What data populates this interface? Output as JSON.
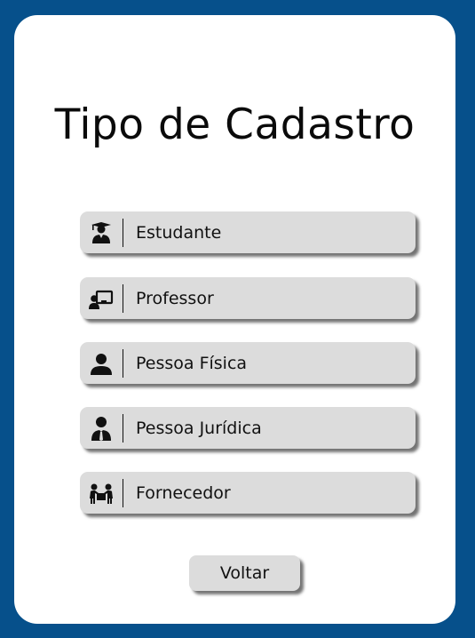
{
  "title": "Tipo de Cadastro",
  "options": [
    {
      "label": "Estudante",
      "icon": "graduate-icon"
    },
    {
      "label": "Professor",
      "icon": "teacher-board-icon"
    },
    {
      "label": "Pessoa Física",
      "icon": "person-icon"
    },
    {
      "label": "Pessoa Jurídica",
      "icon": "business-person-icon"
    },
    {
      "label": "Fornecedor",
      "icon": "supplier-people-icon"
    }
  ],
  "back_label": "Voltar",
  "colors": {
    "background": "#06508b",
    "card": "#ffffff",
    "button": "#dcdcdc"
  }
}
